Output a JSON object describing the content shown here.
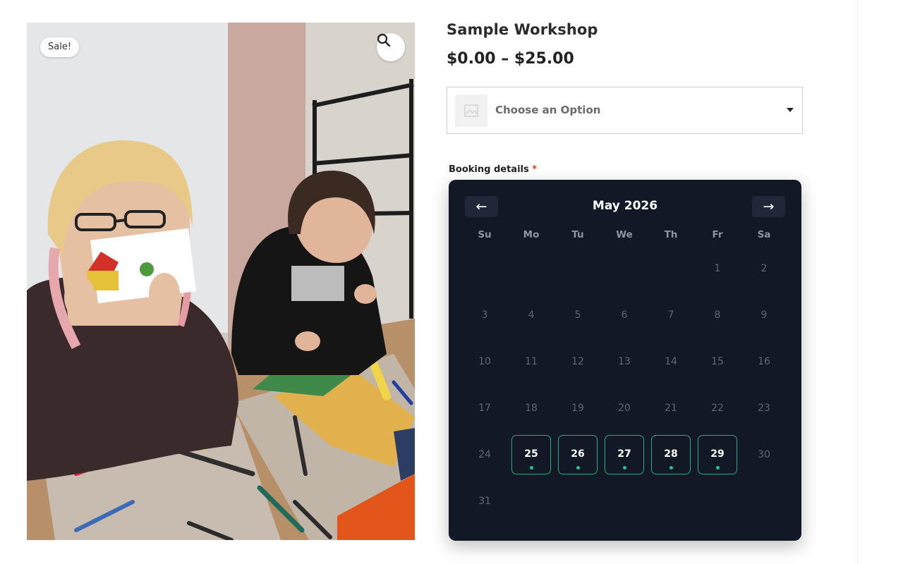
{
  "gallery": {
    "sale_badge": "Sale!",
    "zoom_icon": "search-icon",
    "image_alt": "Two people doing paper crafts at a table"
  },
  "product": {
    "title": "Sample Workshop",
    "price": "$0.00 – $25.00"
  },
  "option_select": {
    "placeholder": "Choose an Option",
    "thumb_icon": "image-placeholder-icon",
    "caret_icon": "caret-down-icon"
  },
  "booking": {
    "label": "Booking details",
    "required_mark": "*"
  },
  "calendar": {
    "prev_label": "←",
    "next_label": "→",
    "month_label": "May 2026",
    "weekdays": [
      "Su",
      "Mo",
      "Tu",
      "We",
      "Th",
      "Fr",
      "Sa"
    ],
    "days": [
      "1",
      "2",
      "3",
      "4",
      "5",
      "6",
      "7",
      "8",
      "9",
      "10",
      "11",
      "12",
      "13",
      "14",
      "15",
      "16",
      "17",
      "18",
      "19",
      "20",
      "21",
      "22",
      "23",
      "24",
      "25",
      "26",
      "27",
      "28",
      "29",
      "30",
      "31"
    ],
    "available_days": [
      25,
      26,
      27,
      28,
      29
    ],
    "colors": {
      "background": "#121826",
      "available_border": "#1fae7f",
      "available_dot": "#1fc58a"
    }
  }
}
